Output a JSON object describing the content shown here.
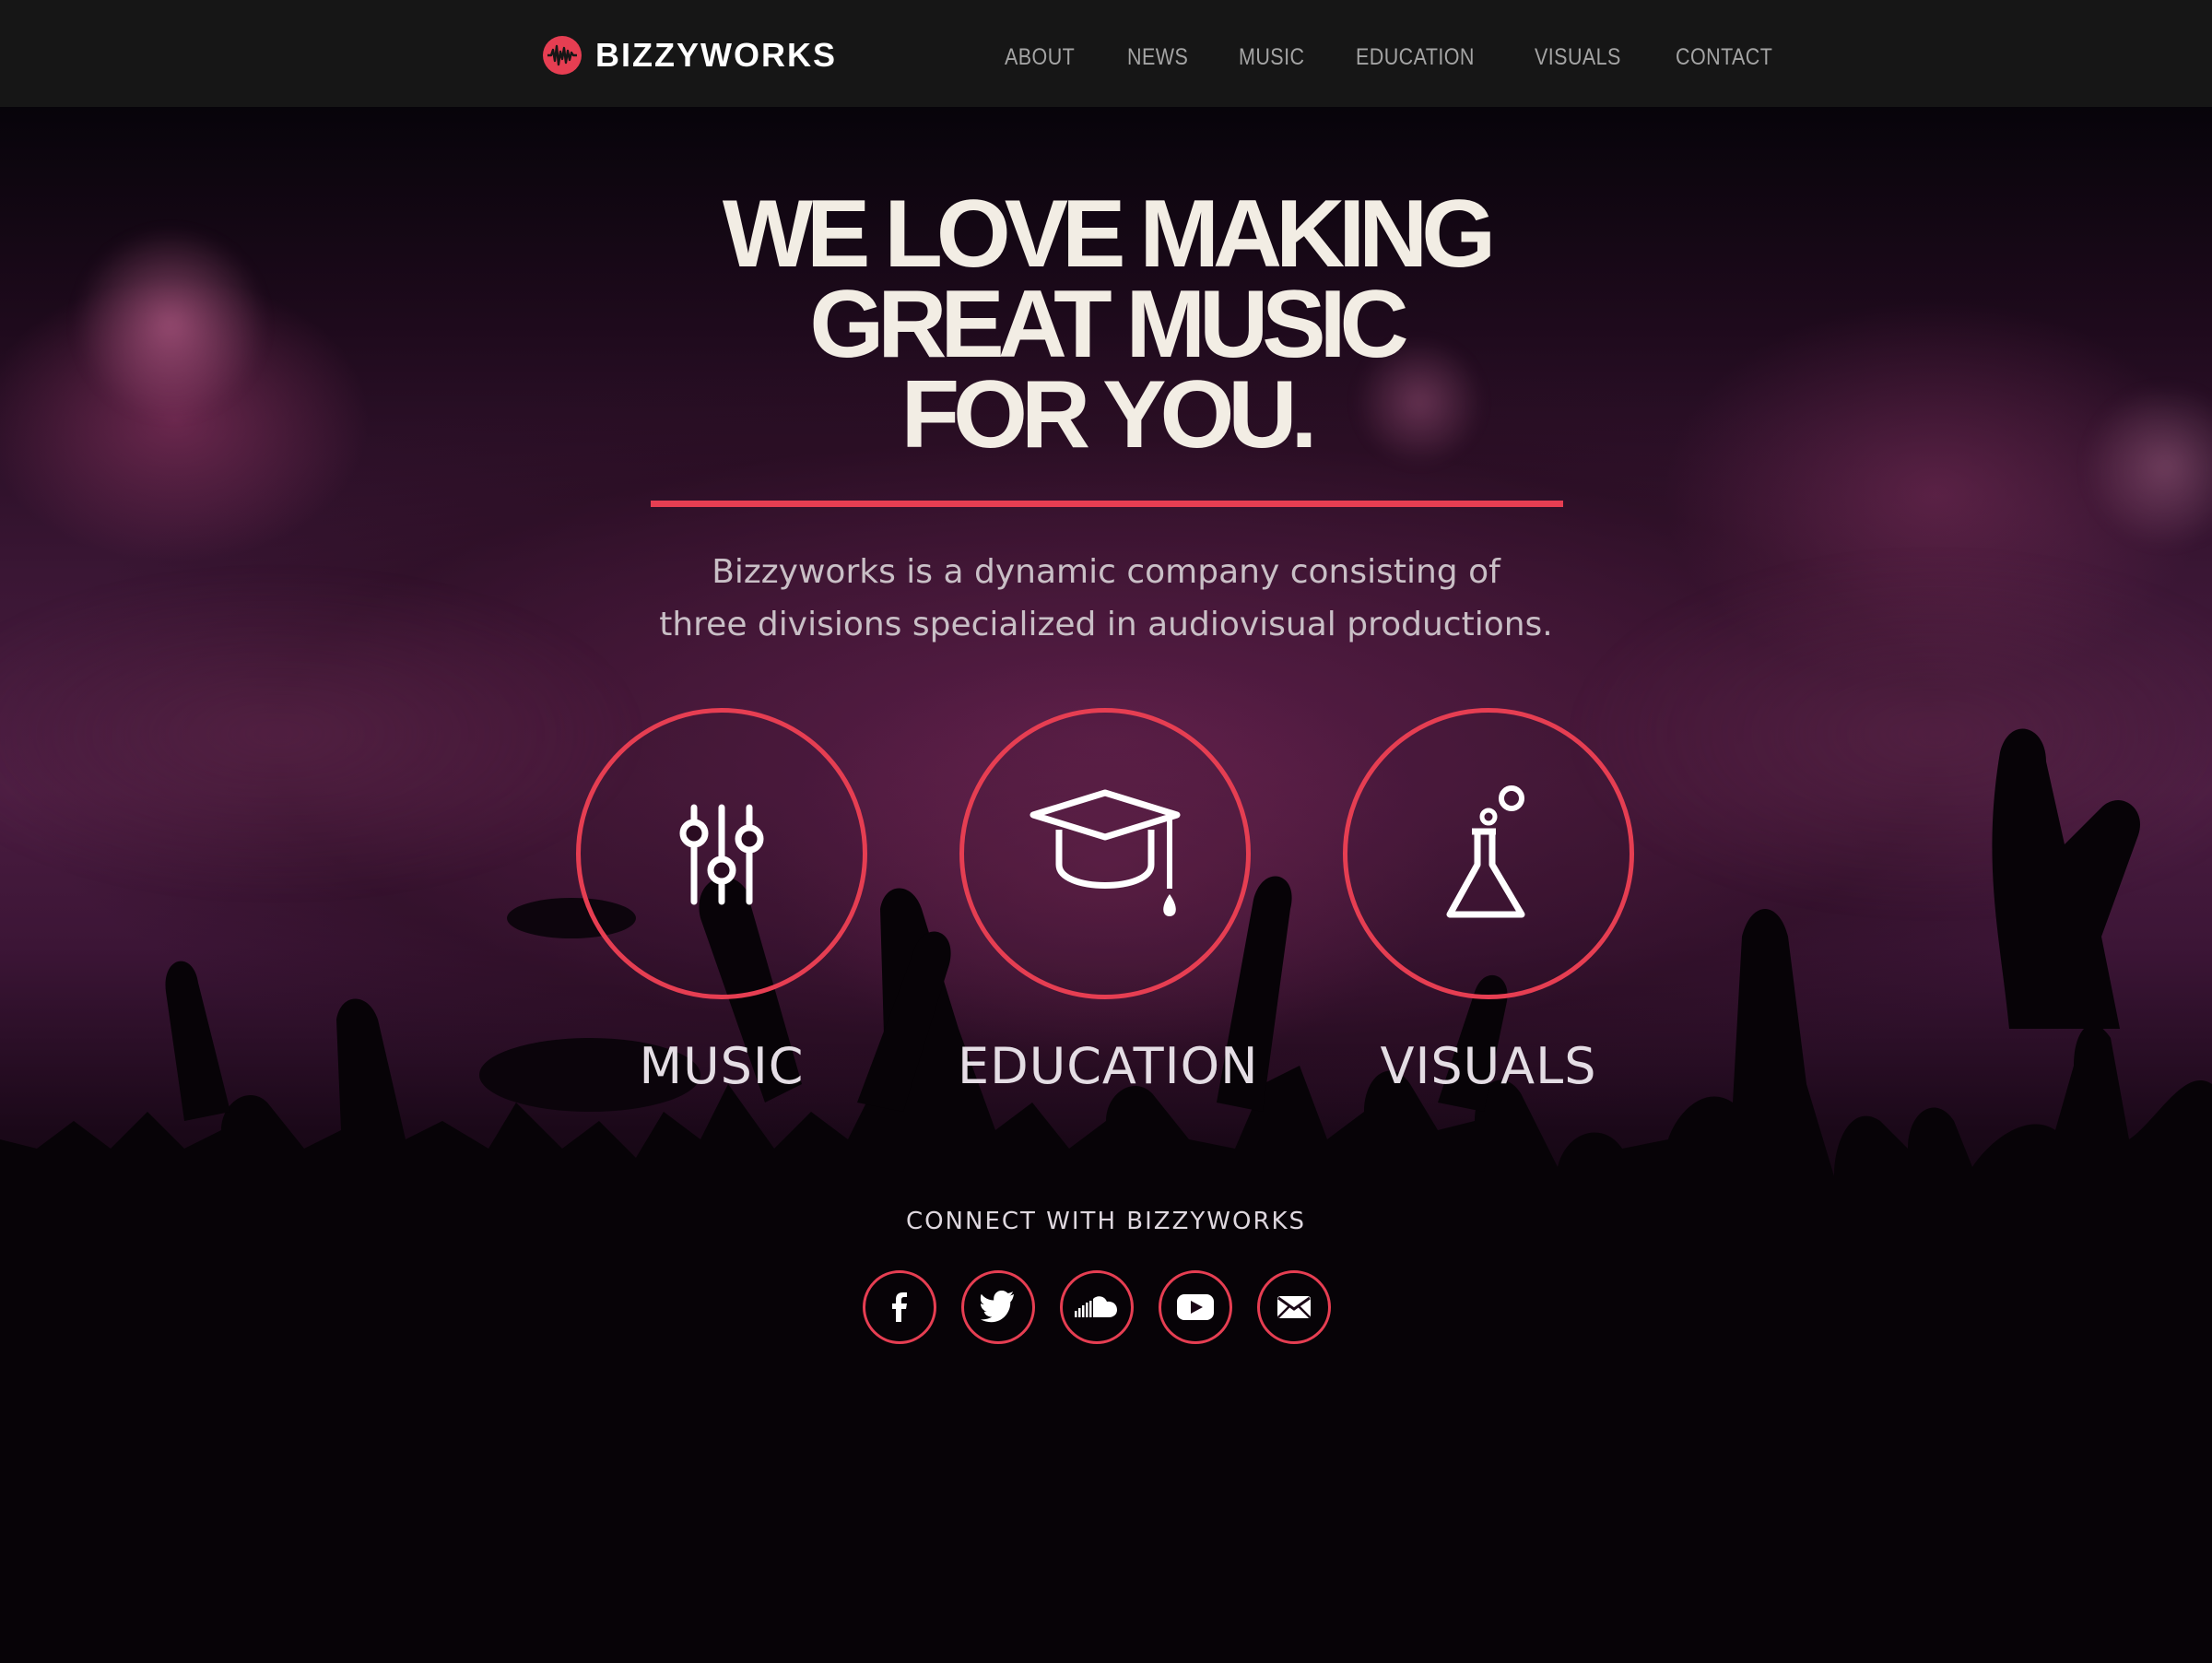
{
  "brand": {
    "name": "BIZZYWORKS",
    "accent_color": "#e63e52",
    "logo_icon": "waveform-disc-icon"
  },
  "nav": {
    "items": [
      {
        "label": "ABOUT"
      },
      {
        "label": "NEWS"
      },
      {
        "label": "MUSIC"
      },
      {
        "label": "EDUCATION"
      },
      {
        "label": "VISUALS"
      },
      {
        "label": "CONTACT"
      }
    ]
  },
  "hero": {
    "headline": "WE LOVE MAKING\nGREAT MUSIC\nFOR YOU.",
    "intro": "Bizzyworks is a dynamic company consisting of\nthree divisions specialized in audiovisual productions."
  },
  "divisions": [
    {
      "label": "MUSIC",
      "icon": "mixer-sliders-icon"
    },
    {
      "label": "EDUCATION",
      "icon": "graduation-cap-icon"
    },
    {
      "label": "VISUALS",
      "icon": "lab-flask-icon"
    }
  ],
  "connect": {
    "title": "CONNECT WITH BIZZYWORKS",
    "icons": [
      "facebook-icon",
      "twitter-icon",
      "soundcloud-icon",
      "youtube-icon",
      "email-icon"
    ]
  }
}
